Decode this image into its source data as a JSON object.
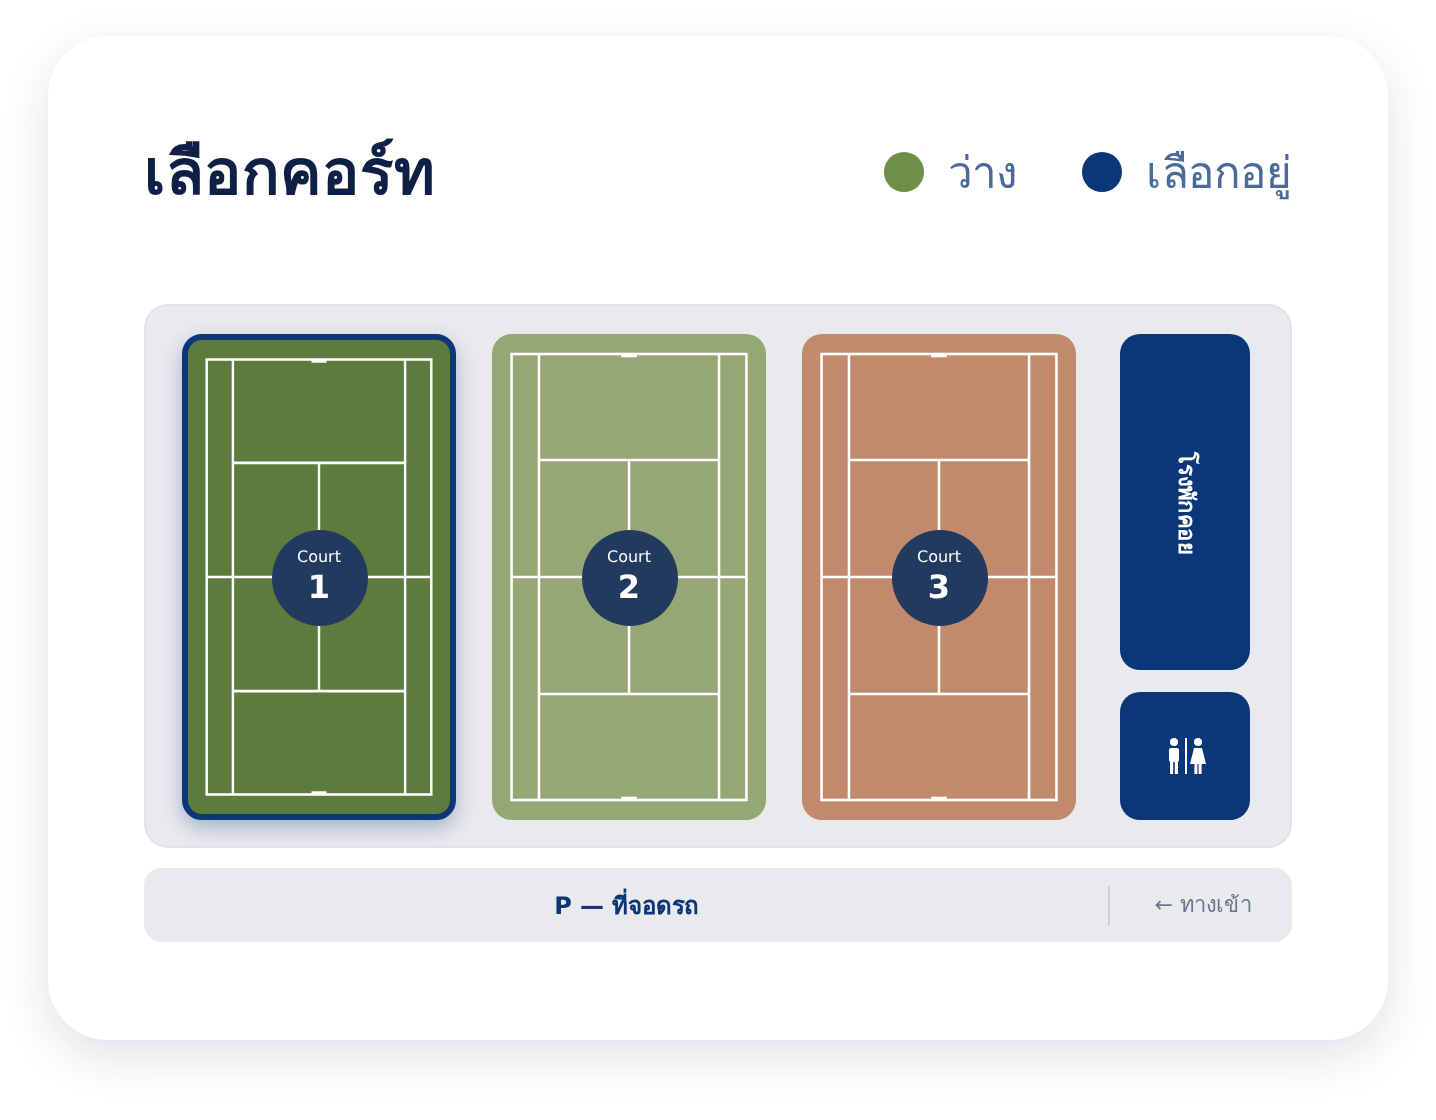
{
  "title": "เลือกคอร์ท",
  "legend": [
    {
      "label": "ว่าง",
      "color": "#6f8f47"
    },
    {
      "label": "เลือกอยู่",
      "color": "#0b3677"
    }
  ],
  "courts": [
    {
      "label": "Court",
      "number": "1",
      "color": "#5e7b3e",
      "selected": true
    },
    {
      "label": "Court",
      "number": "2",
      "color": "#95a775",
      "selected": false
    },
    {
      "label": "Court",
      "number": "3",
      "color": "#c28a6c",
      "selected": false
    }
  ],
  "facilities": [
    {
      "kind": "building",
      "label": "โรงพักคอย"
    },
    {
      "kind": "restroom"
    }
  ],
  "parking": {
    "label": "P — ที่จอดรถ",
    "entrance": "← ทางเข้า"
  }
}
